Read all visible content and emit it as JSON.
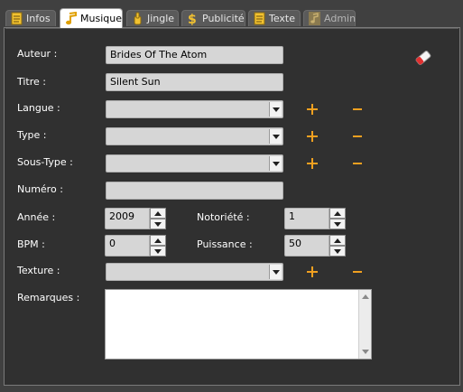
{
  "tabs": [
    {
      "label": "Infos",
      "icon": "document-icon"
    },
    {
      "label": "Musique",
      "icon": "music-note-icon"
    },
    {
      "label": "Jingle",
      "icon": "hand-icon"
    },
    {
      "label": "Publicité",
      "icon": "dollar-icon"
    },
    {
      "label": "Texte",
      "icon": "document-icon"
    },
    {
      "label": "Admin",
      "icon": "music-note-icon"
    }
  ],
  "active_tab": "Musique",
  "form": {
    "auteur_label": "Auteur :",
    "auteur_value": "Brides Of The Atom",
    "titre_label": "Titre :",
    "titre_value": "Silent Sun",
    "langue_label": "Langue :",
    "langue_value": "",
    "type_label": "Type :",
    "type_value": "",
    "soustype_label": "Sous-Type :",
    "soustype_value": "",
    "numero_label": "Numéro :",
    "numero_value": "",
    "annee_label": "Année :",
    "annee_value": "2009",
    "notoriete_label": "Notoriété :",
    "notoriete_value": "1",
    "bpm_label": "BPM :",
    "bpm_value": "0",
    "puissance_label": "Puissance :",
    "puissance_value": "50",
    "texture_label": "Texture :",
    "texture_value": "",
    "remarques_label": "Remarques :",
    "remarques_value": ""
  },
  "colors": {
    "background": "#404040",
    "panel": "#303030",
    "field": "#d6d6d6",
    "accent_plus_minus": "#f0a020"
  }
}
